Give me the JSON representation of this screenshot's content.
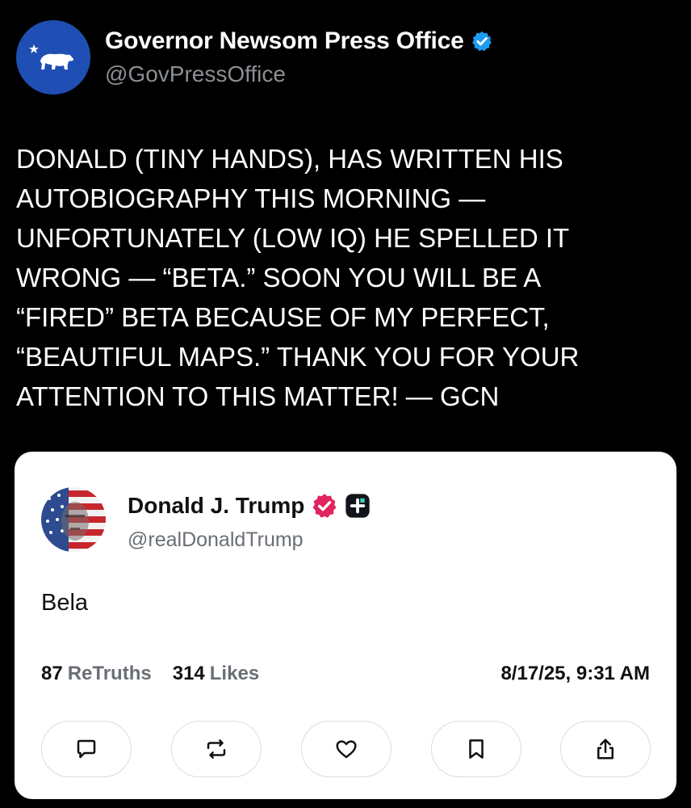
{
  "outer_post": {
    "author_name": "Governor Newsom Press Office",
    "author_handle": "@GovPressOffice",
    "body": "DONALD (TINY HANDS), HAS WRITTEN HIS\nAUTOBIOGRAPHY THIS MORNING —\nUNFORTUNATELY (LOW IQ) HE SPELLED IT\nWRONG — “BETA.” SOON YOU WILL BE A\n“FIRED” BETA BECAUSE OF MY PERFECT,\n“BEAUTIFUL MAPS.” THANK YOU FOR YOUR\nATTENTION TO THIS MATTER! — GCN"
  },
  "embedded_post": {
    "author_name": "Donald J. Trump",
    "author_handle": "@realDonaldTrump",
    "body": "Bela",
    "retruths_count": "87",
    "retruths_label": "ReTruths",
    "likes_count": "314",
    "likes_label": "Likes",
    "timestamp": "8/17/25, 9:31 AM",
    "actions": [
      "reply-icon",
      "retruth-icon",
      "like-icon",
      "bookmark-icon",
      "share-icon"
    ]
  },
  "colors": {
    "background": "#000000",
    "verified_blue": "#1d9bf0",
    "verified_pink": "#e0245e",
    "avatar_blue": "#1f4fb4"
  }
}
